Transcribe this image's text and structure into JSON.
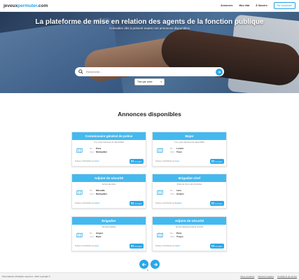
{
  "nav": {
    "logo_part1": "jeveux",
    "logo_part2": "permuter",
    "logo_part3": ".com",
    "links": [
      "Annonces",
      "Mon état",
      "À Savoirs"
    ],
    "connect_label": "Se connecter"
  },
  "hero": {
    "title": "La plateforme de mise en relation des agents de la fonction publique",
    "subtitle": "Consultez dès à présent toutes nos annonces disponibles",
    "search_placeholder": "Recherche...",
    "sort_value": "Trier par ordre"
  },
  "section_title": "Annonces disponibles",
  "labels": {
    "from": "De :",
    "to": "Vers :",
    "contact": "Contact"
  },
  "cards": [
    {
      "title": "Commissaire général de police",
      "subtitle": "Il n'y a pas d'annonce de disponibilité",
      "from": "Paris",
      "to": "Montpellier",
      "meta": "Publiée le 05/10/2021 par",
      "author": "Admin"
    },
    {
      "title": "Major",
      "subtitle": "Il n'y a pas d'annonce de disponibilité",
      "from": "Lorient",
      "to": "Tours",
      "meta": "Publiée le 05/10/2021 par",
      "author": "Agent"
    },
    {
      "title": "Adjoint de sécurité",
      "subtitle": "Service de police",
      "from": "Marseille",
      "to": "Montpellier",
      "meta": "Publiée le 05/10/2021 par",
      "author": "Adjoint"
    },
    {
      "title": "Brigadier-chef",
      "subtitle": "Police de l'Air et des Frontières",
      "from": "Lens",
      "to": "Amiens",
      "meta": "Publiée le 05/10/2021 par",
      "author": "Brigadier"
    },
    {
      "title": "Brigadier",
      "subtitle": "Sécurité publique",
      "from": "Angers",
      "to": "Dijon",
      "meta": "Publiée le 05/10/2021 par",
      "author": "Agent"
    },
    {
      "title": "Adjoint de sécurité",
      "subtitle": "Service départemental de sécurité",
      "from": "Paris",
      "to": "Troyes",
      "meta": "Publiée le 05/10/2021 par",
      "author": "Adjoint"
    }
  ],
  "pagination": {
    "page": "1"
  },
  "footer": {
    "copyright": "Permutations All Rights reserved - 2021 copyright ©",
    "links": [
      "Nous contacter",
      "Mentions légales",
      "Conditions de ventes"
    ]
  },
  "colors": {
    "accent": "#44b9ef",
    "button": "#2aa7e8"
  }
}
